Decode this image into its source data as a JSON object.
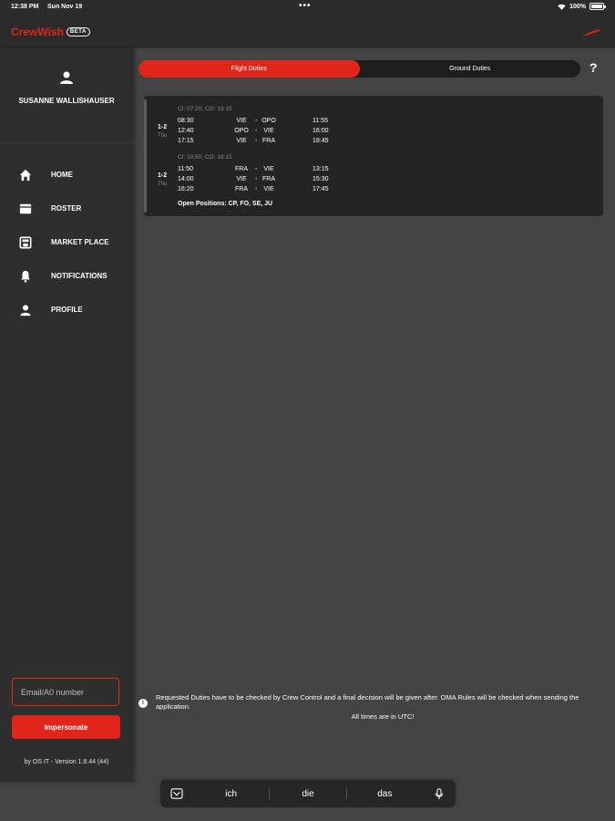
{
  "status": {
    "time": "12:38 PM",
    "date": "Sun Nov 19",
    "battery": "100%"
  },
  "app": {
    "name": "CrewWish",
    "badge": "BETA",
    "logo_icon": "airline-logo-icon"
  },
  "sidebar": {
    "user_name": "SUSANNE WALLISHAUSER",
    "items": [
      {
        "label": "HOME",
        "icon": "home-icon"
      },
      {
        "label": "ROSTER",
        "icon": "roster-icon"
      },
      {
        "label": "MARKET PLACE",
        "icon": "market-place-icon"
      },
      {
        "label": "NOTIFICATIONS",
        "icon": "bell-icon"
      },
      {
        "label": "PROFILE",
        "icon": "person-icon"
      }
    ],
    "email_placeholder": "Email/A0 number",
    "impersonate_label": "Impersonate",
    "version": "by OS IT - Version 1.8.44 (44)"
  },
  "tabs": [
    {
      "label": "Flight Duties",
      "active": true
    },
    {
      "label": "Ground Duties",
      "active": false
    }
  ],
  "help_label": "?",
  "duties": [
    {
      "day": "1-2",
      "weekday": "Thu",
      "ci_co": "CI: 07:20, CO: 19:15",
      "legs": [
        {
          "dep": "08:30",
          "from": "VIE",
          "to": "OPO",
          "arr": "11:55"
        },
        {
          "dep": "12:40",
          "from": "OPO",
          "to": "VIE",
          "arr": "16:00"
        },
        {
          "dep": "17:15",
          "from": "VIE",
          "to": "FRA",
          "arr": "18:45"
        }
      ]
    },
    {
      "day": "1-2",
      "weekday": "Thu",
      "ci_co": "CI: 10:50, CO: 18:15",
      "legs": [
        {
          "dep": "11:50",
          "from": "FRA",
          "to": "VIE",
          "arr": "13:15"
        },
        {
          "dep": "14:00",
          "from": "VIE",
          "to": "FRA",
          "arr": "15:30"
        },
        {
          "dep": "16:20",
          "from": "FRA",
          "to": "VIE",
          "arr": "17:45"
        }
      ]
    }
  ],
  "open_positions": "Open Positions: CP, FO, SE, JU",
  "note": "Requested Duties have to be checked by Crew Control and a final decision will be given after. OMA Rules will be checked when sending the application.",
  "utc_note": "All times are in UTC!",
  "keyboard": {
    "suggestions": [
      "ich",
      "die",
      "das"
    ]
  },
  "colors": {
    "accent": "#e0261b",
    "background": "#434343",
    "sidebar": "#2e2e2e",
    "card": "#242424"
  }
}
